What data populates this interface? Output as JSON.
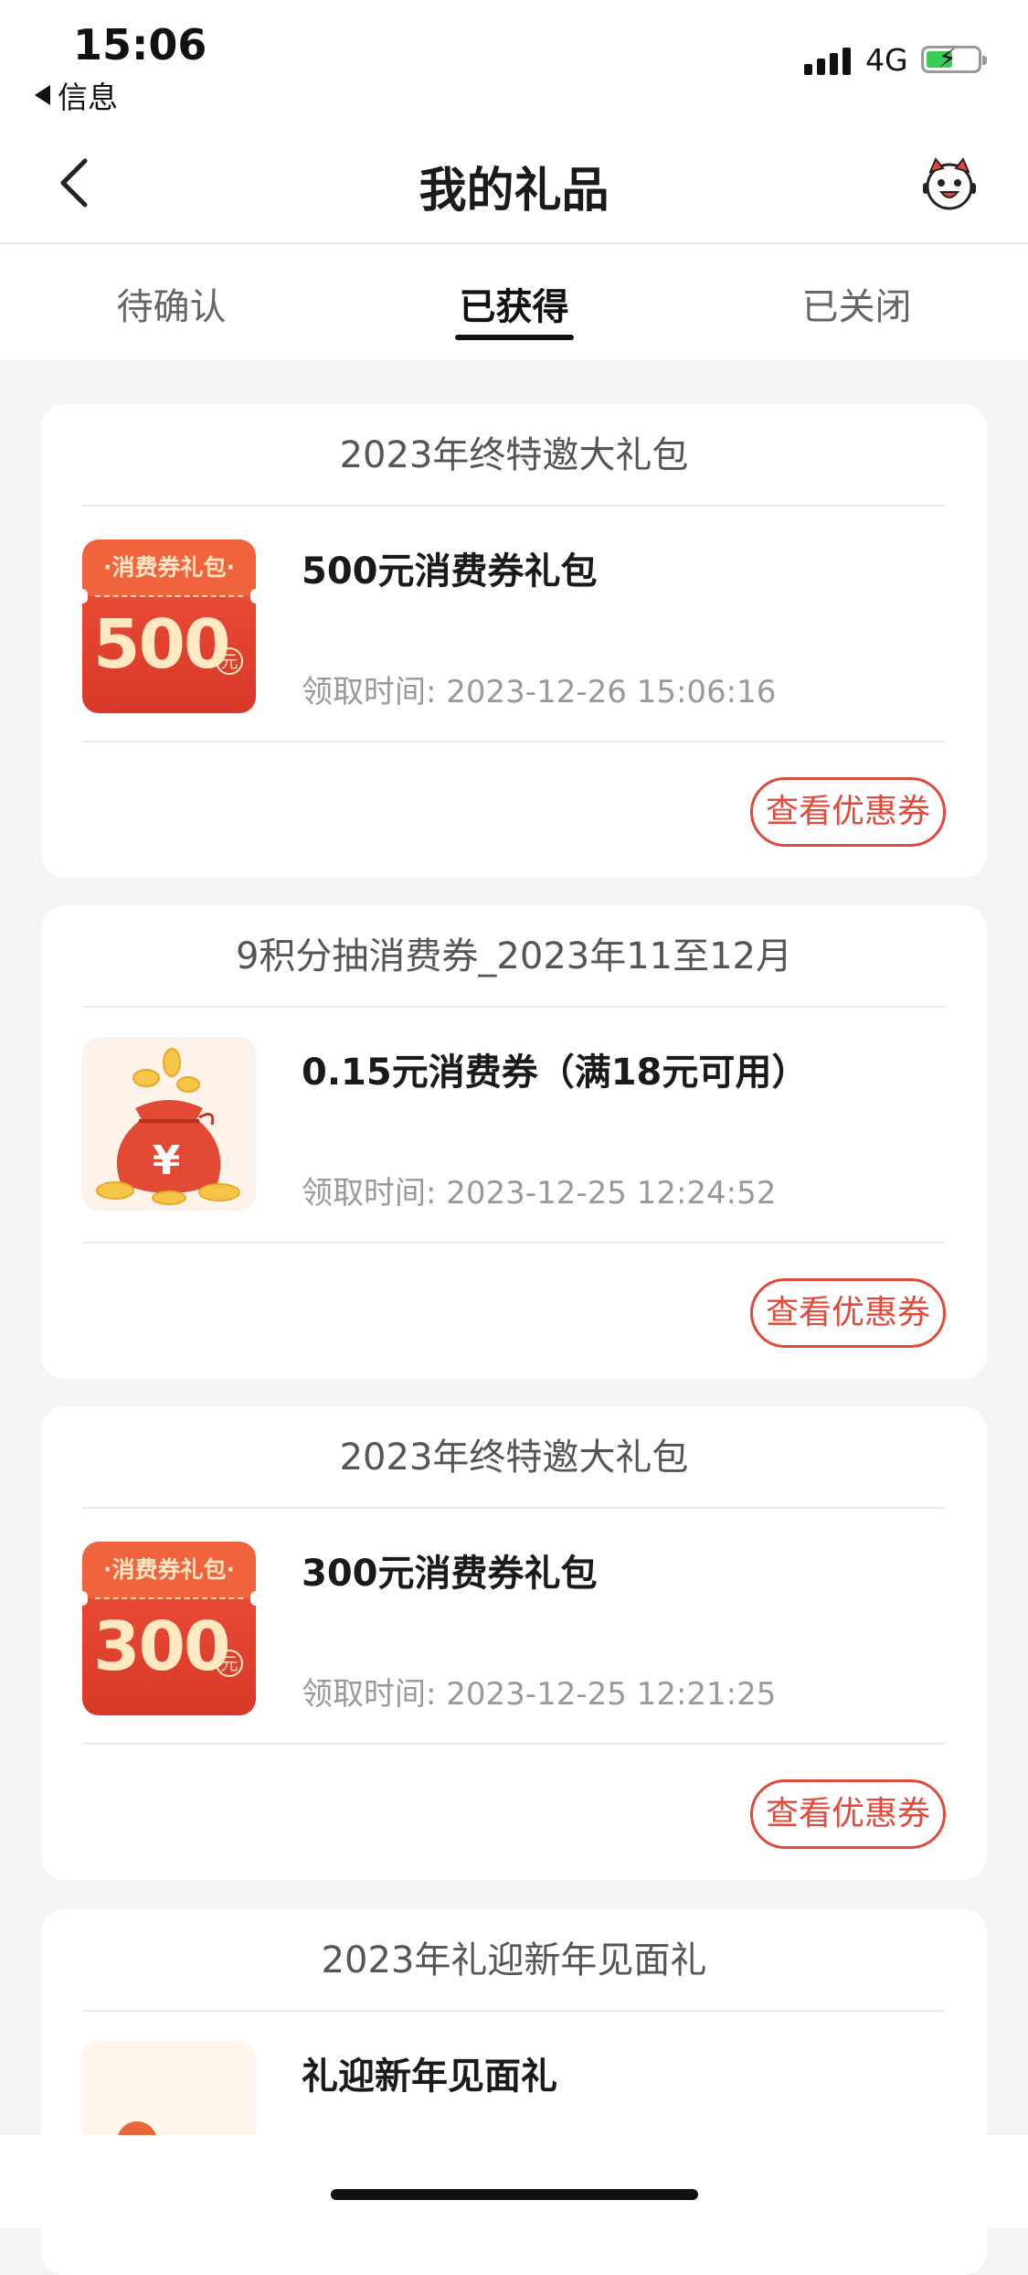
{
  "status_bar": {
    "time": "15:06",
    "back_app": "信息",
    "network": "4G"
  },
  "nav": {
    "title": "我的礼品"
  },
  "tabs": [
    {
      "label": "待确认",
      "active": false
    },
    {
      "label": "已获得",
      "active": true
    },
    {
      "label": "已关闭",
      "active": false
    }
  ],
  "gifts": [
    {
      "header": "2023年终特邀大礼包",
      "name": "500元消费券礼包",
      "time_label": "领取时间:",
      "time": "2023-12-26 15:06:16",
      "thumb": "coupon",
      "coupon_title": "·消费券礼包·",
      "coupon_amount": "500",
      "coupon_unit": "元",
      "button": "查看优惠券"
    },
    {
      "header": "9积分抽消费券_2023年11至12月",
      "name": "0.15元消费券（满18元可用）",
      "time_label": "领取时间:",
      "time": "2023-12-25 12:24:52",
      "thumb": "money-bag",
      "button": "查看优惠券"
    },
    {
      "header": "2023年终特邀大礼包",
      "name": "300元消费券礼包",
      "time_label": "领取时间:",
      "time": "2023-12-25 12:21:25",
      "thumb": "coupon",
      "coupon_title": "·消费券礼包·",
      "coupon_amount": "300",
      "coupon_unit": "元",
      "button": "查看优惠券"
    },
    {
      "header": "2023年礼迎新年见面礼",
      "name": "礼迎新年见面礼",
      "thumb": "new-year-gift"
    }
  ],
  "colors": {
    "accent": "#e04a3a",
    "coupon_top": "#f0643d",
    "coupon_bottom": "#d83828",
    "background": "#f4f4f6"
  }
}
